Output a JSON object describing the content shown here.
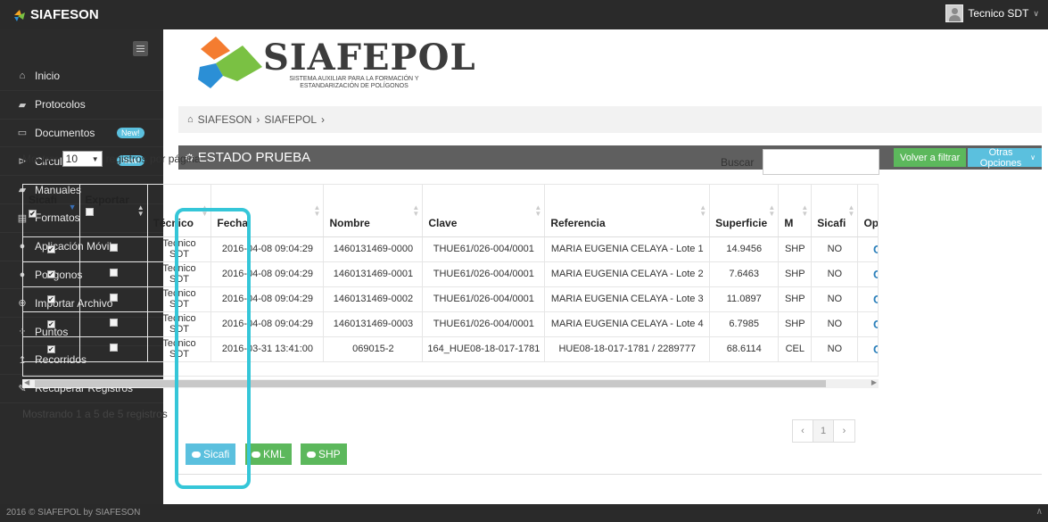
{
  "app": {
    "brand": "SIAFESON",
    "user": "Tecnico SDT"
  },
  "sidebar": {
    "items": [
      {
        "label": "Inicio",
        "icon": "home-icon",
        "glyph": "⌂"
      },
      {
        "label": "Protocolos",
        "icon": "book-icon",
        "glyph": "▰"
      },
      {
        "label": "Documentos",
        "icon": "folder-icon",
        "glyph": "▭",
        "badge": "New!"
      },
      {
        "label": "Circulares",
        "icon": "folder-open-icon",
        "glyph": "⊳",
        "badge": "New!"
      },
      {
        "label": "Manuales",
        "icon": "book-icon",
        "glyph": "▰"
      },
      {
        "label": "Formatos",
        "icon": "file-icon",
        "glyph": "▤"
      },
      {
        "label": "Aplicación Móvil",
        "icon": "android-icon",
        "glyph": "●"
      },
      {
        "label": "Polígonos",
        "icon": "circle-icon",
        "glyph": "●"
      },
      {
        "label": "Importar Archivo",
        "icon": "upload-icon",
        "glyph": "⊕"
      },
      {
        "label": "Puntos",
        "icon": "dots-icon",
        "glyph": "⁘"
      },
      {
        "label": "Recorridos",
        "icon": "route-icon",
        "glyph": "↥"
      },
      {
        "label": "Recuperar Registros",
        "icon": "wrench-icon",
        "glyph": "✎"
      }
    ]
  },
  "logo": {
    "title": "SIAFEPOL",
    "subtitle_line1": "SISTEMA AUXILIAR PARA LA FORMACIÓN Y",
    "subtitle_line2": "ESTANDARIZACIÓN DE POLÍGONOS"
  },
  "breadcrumb": {
    "home": "SIAFESON",
    "sep1": "›",
    "current": "SIAFEPOL",
    "sep2": "›"
  },
  "panel": {
    "title": "ESTADO PRUEBA",
    "filter_button": "Volver a filtrar",
    "options_button": "Otras Opciones"
  },
  "table_controls": {
    "show_label": "Mostrar",
    "page_length": "10",
    "per_page_label": "registros por página",
    "search_label": "Buscar",
    "search_value": ""
  },
  "table": {
    "headers": [
      "Sicafi",
      "Exportar",
      "Técnico",
      "Fecha",
      "Nombre",
      "Clave",
      "Referencia",
      "Superficie",
      "M",
      "Sicafi",
      "Op"
    ],
    "rows": [
      {
        "sicafi": true,
        "exportar": false,
        "tecnico": "Tecnico SDT",
        "fecha": "2016-04-08 09:04:29",
        "nombre": "1460131469-0000",
        "clave": "THUE61/026-004/0001",
        "referencia": "MARIA EUGENIA CELAYA - Lote 1",
        "superficie": "14.9456",
        "m": "SHP",
        "sicafi2": "NO",
        "op": "C"
      },
      {
        "sicafi": true,
        "exportar": false,
        "tecnico": "Tecnico SDT",
        "fecha": "2016-04-08 09:04:29",
        "nombre": "1460131469-0001",
        "clave": "THUE61/026-004/0001",
        "referencia": "MARIA EUGENIA CELAYA - Lote 2",
        "superficie": "7.6463",
        "m": "SHP",
        "sicafi2": "NO",
        "op": "C"
      },
      {
        "sicafi": true,
        "exportar": false,
        "tecnico": "Tecnico SDT",
        "fecha": "2016-04-08 09:04:29",
        "nombre": "1460131469-0002",
        "clave": "THUE61/026-004/0001",
        "referencia": "MARIA EUGENIA CELAYA - Lote 3",
        "superficie": "11.0897",
        "m": "SHP",
        "sicafi2": "NO",
        "op": "C"
      },
      {
        "sicafi": true,
        "exportar": false,
        "tecnico": "Tecnico SDT",
        "fecha": "2016-04-08 09:04:29",
        "nombre": "1460131469-0003",
        "clave": "THUE61/026-004/0001",
        "referencia": "MARIA EUGENIA CELAYA - Lote 4",
        "superficie": "6.7985",
        "m": "SHP",
        "sicafi2": "NO",
        "op": "C"
      },
      {
        "sicafi": true,
        "exportar": false,
        "tecnico": "Tecnico SDT",
        "fecha": "2016-03-31 13:41:00",
        "nombre": "069015-2",
        "clave": "164_HUE08-18-017-1781",
        "referencia": "HUE08-18-017-1781 / 2289777",
        "superficie": "68.6114",
        "m": "CEL",
        "sicafi2": "NO",
        "op": "C"
      }
    ]
  },
  "info": "Mostrando 1 a 5 de 5 registros",
  "pager": {
    "prev": "‹",
    "page": "1",
    "next": "›"
  },
  "export_buttons": {
    "sicafi": "Sicafi",
    "kml": "KML",
    "shp": "SHP"
  },
  "footer": "2016 © SIAFEPOL by SIAFESON",
  "colors": {
    "dark": "#2a2a2a",
    "panel_head": "#5f5f5f",
    "green": "#5cb85c",
    "blue": "#5bc0de",
    "highlight": "#35c6d8"
  }
}
